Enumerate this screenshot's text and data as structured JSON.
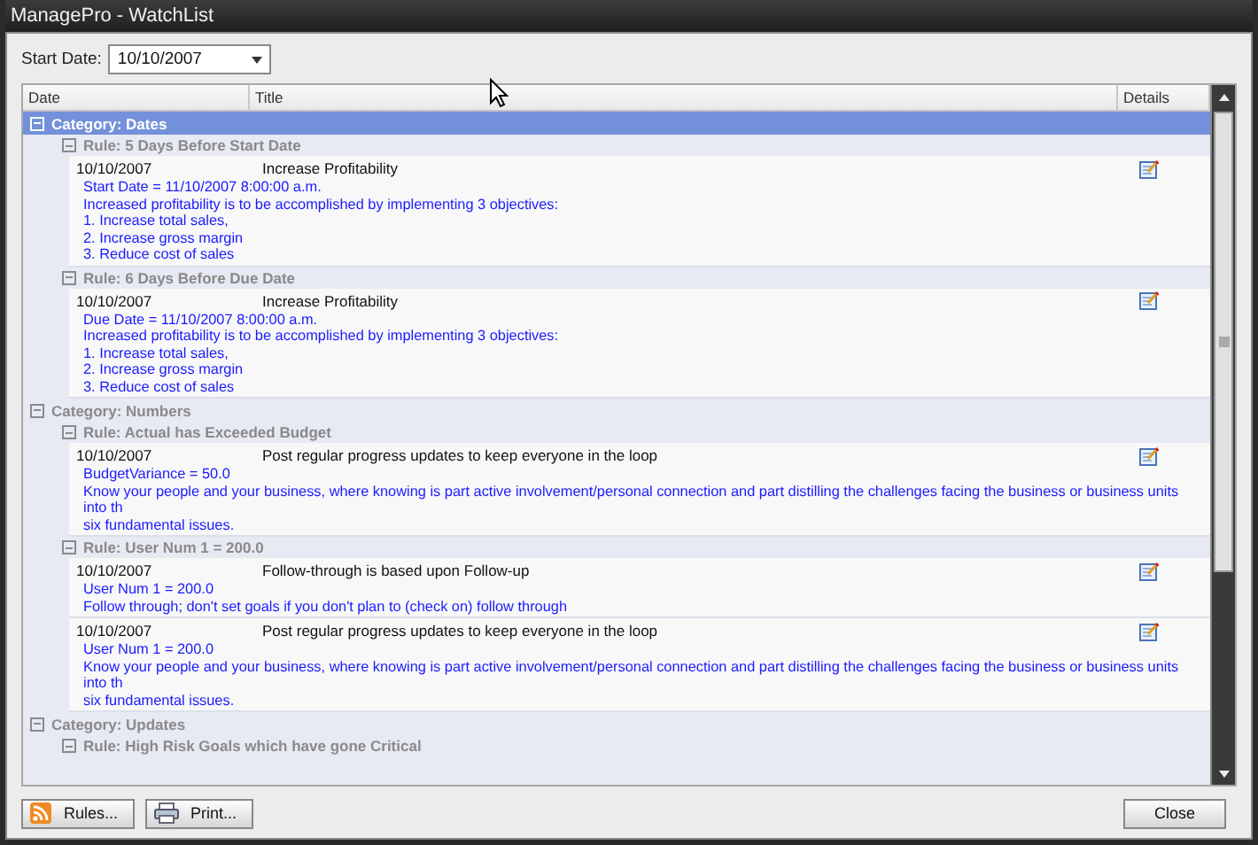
{
  "window": {
    "title": "ManagePro - WatchList"
  },
  "start_date": {
    "label": "Start Date:",
    "value": "10/10/2007"
  },
  "table": {
    "columns": [
      "Date",
      "Title",
      "Details"
    ],
    "categories": [
      {
        "name": "Category: Dates",
        "selected": true,
        "expanded": true,
        "rules": [
          {
            "name": "Rule: 5 Days Before Start Date",
            "expanded": true,
            "items": [
              {
                "date": "10/10/2007",
                "title": "Increase Profitability",
                "details": [
                  "Start Date = 11/10/2007 8:00:00 a.m.",
                  "Increased profitability is to be accomplished by implementing 3 objectives:",
                  "1. Increase total sales,",
                  "2. Increase gross margin",
                  "3. Reduce cost of sales"
                ]
              }
            ]
          },
          {
            "name": "Rule: 6 Days Before Due Date",
            "expanded": true,
            "items": [
              {
                "date": "10/10/2007",
                "title": "Increase Profitability",
                "details": [
                  "Due Date = 11/10/2007 8:00:00 a.m.",
                  "Increased profitability is to be accomplished by implementing 3 objectives:",
                  "1. Increase total sales,",
                  "2. Increase gross margin",
                  "3. Reduce cost of sales"
                ]
              }
            ]
          }
        ]
      },
      {
        "name": "Category: Numbers",
        "selected": false,
        "expanded": true,
        "rules": [
          {
            "name": "Rule: Actual has Exceeded Budget",
            "expanded": true,
            "items": [
              {
                "date": "10/10/2007",
                "title": "Post regular progress updates to keep everyone in the loop",
                "details": [
                  "BudgetVariance = 50.0",
                  "Know your people and your business, where knowing is part active involvement/personal connection and part distilling the challenges facing the business or business units into th",
                  "six fundamental issues."
                ]
              }
            ]
          },
          {
            "name": "Rule: User Num 1 = 200.0",
            "expanded": true,
            "items": [
              {
                "date": "10/10/2007",
                "title": "Follow-through is based upon Follow-up",
                "details": [
                  "User Num 1 = 200.0",
                  "Follow through; don't set goals if you don't plan to (check on) follow through"
                ]
              },
              {
                "date": "10/10/2007",
                "title": "Post regular progress updates to keep everyone in the loop",
                "details": [
                  "User Num 1 = 200.0",
                  "Know your people and your business, where knowing is part active involvement/personal connection and part distilling the challenges facing the business or business units into th",
                  "six fundamental issues."
                ]
              }
            ]
          }
        ]
      },
      {
        "name": "Category: Updates",
        "selected": false,
        "expanded": true,
        "rules": [
          {
            "name": "Rule: High Risk Goals which have gone Critical",
            "expanded": true
          }
        ]
      }
    ]
  },
  "buttons": [
    {
      "label": "Rules...",
      "kind": "rules"
    },
    {
      "label": "Print...",
      "kind": "print"
    }
  ],
  "close_button": {
    "label": "Close"
  }
}
